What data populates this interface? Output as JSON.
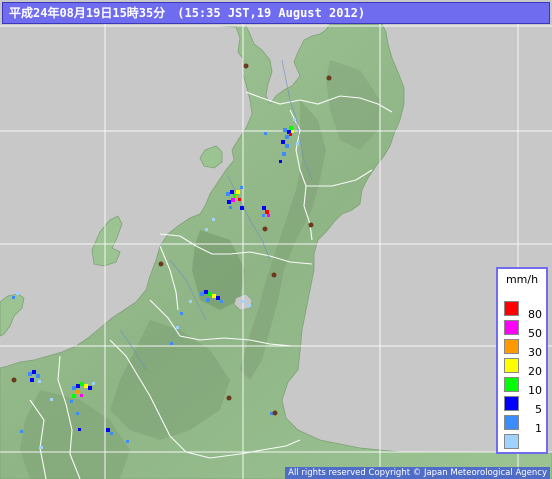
{
  "header": {
    "timestamp": "平成24年08月19日15時35分　(15:35 JST,19 August 2012)"
  },
  "legend": {
    "unit": "mm/h",
    "levels": [
      {
        "label": "80",
        "color": "#ff0000"
      },
      {
        "label": "50",
        "color": "#ff00ff"
      },
      {
        "label": "30",
        "color": "#ff9900"
      },
      {
        "label": "20",
        "color": "#ffff00"
      },
      {
        "label": "10",
        "color": "#00ff00"
      },
      {
        "label": "5",
        "color": "#0000ff"
      },
      {
        "label": "1",
        "color": "#3c8cff"
      },
      {
        "label": "",
        "color": "#a0d2ff"
      }
    ]
  },
  "footer": {
    "copyright": "All rights reserved  Copyright © Japan Meteorological Agency"
  },
  "colors": {
    "sea": "#c8c8c8",
    "land_low": "#9bc392",
    "land_mid": "#86ac7f",
    "land_high": "#6f9567",
    "grid": "#ffffff",
    "prefecture_border": "#ffffff",
    "city_marker": "#6b3a1e",
    "title_bar": "#6f6cf0"
  }
}
